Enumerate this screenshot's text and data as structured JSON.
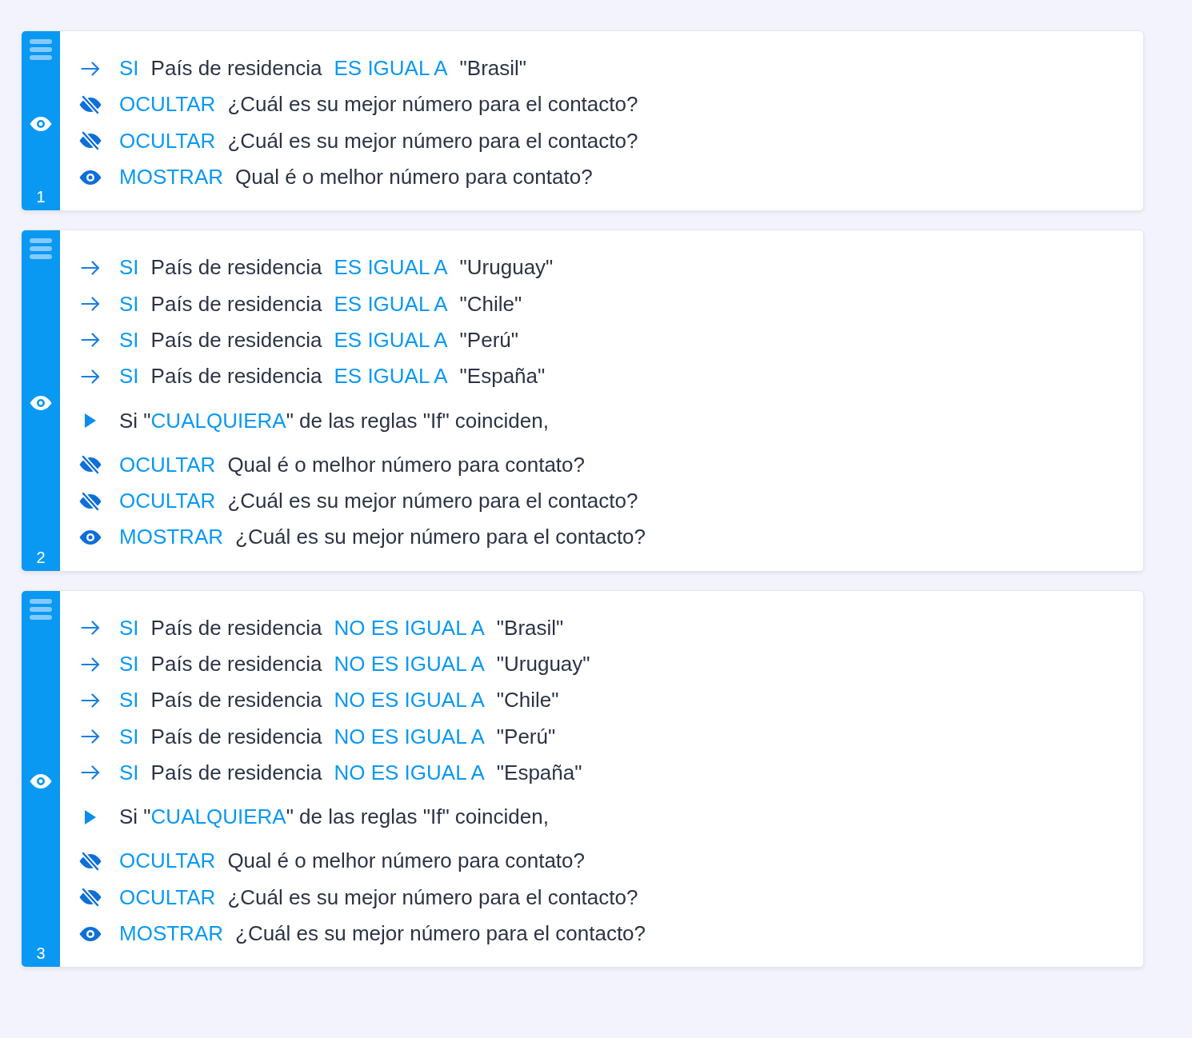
{
  "rules": [
    {
      "number": "1",
      "conditions": [
        {
          "keyword": "SI",
          "field": "País de residencia",
          "operator": "ES IGUAL A",
          "value": "\"Brasil\""
        }
      ],
      "actions": [
        {
          "kind": "hide",
          "verb": "OCULTAR",
          "target": "¿Cuál es su mejor número para el contacto?"
        },
        {
          "kind": "hide",
          "verb": "OCULTAR",
          "target": "¿Cuál es su mejor número para el contacto?"
        },
        {
          "kind": "show",
          "verb": "MOSTRAR",
          "target": "Qual é o melhor número para contato?"
        }
      ]
    },
    {
      "number": "2",
      "conditions": [
        {
          "keyword": "SI",
          "field": "País de residencia",
          "operator": "ES IGUAL A",
          "value": "\"Uruguay\""
        },
        {
          "keyword": "SI",
          "field": "País de residencia",
          "operator": "ES IGUAL A",
          "value": "\"Chile\""
        },
        {
          "keyword": "SI",
          "field": "País de residencia",
          "operator": "ES IGUAL A",
          "value": "\"Perú\""
        },
        {
          "keyword": "SI",
          "field": "País de residencia",
          "operator": "ES IGUAL A",
          "value": "\"España\""
        }
      ],
      "match": {
        "prefix": "Si \"",
        "keyword": "CUALQUIERA",
        "suffix": "\" de las reglas \"If\" coinciden,"
      },
      "actions": [
        {
          "kind": "hide",
          "verb": "OCULTAR",
          "target": "Qual é o melhor número para contato?"
        },
        {
          "kind": "hide",
          "verb": "OCULTAR",
          "target": "¿Cuál es su mejor número para el contacto?"
        },
        {
          "kind": "show",
          "verb": "MOSTRAR",
          "target": "¿Cuál es su mejor número para el contacto?"
        }
      ]
    },
    {
      "number": "3",
      "conditions": [
        {
          "keyword": "SI",
          "field": "País de residencia",
          "operator": "NO ES IGUAL A",
          "value": "\"Brasil\""
        },
        {
          "keyword": "SI",
          "field": "País de residencia",
          "operator": "NO ES IGUAL A",
          "value": "\"Uruguay\""
        },
        {
          "keyword": "SI",
          "field": "País de residencia",
          "operator": "NO ES IGUAL A",
          "value": "\"Chile\""
        },
        {
          "keyword": "SI",
          "field": "País de residencia",
          "operator": "NO ES IGUAL A",
          "value": "\"Perú\""
        },
        {
          "keyword": "SI",
          "field": "País de residencia",
          "operator": "NO ES IGUAL A",
          "value": "\"España\""
        }
      ],
      "match": {
        "prefix": "Si \"",
        "keyword": "CUALQUIERA",
        "suffix": "\" de las reglas \"If\" coinciden,"
      },
      "actions": [
        {
          "kind": "hide",
          "verb": "OCULTAR",
          "target": "Qual é o melhor número para contato?"
        },
        {
          "kind": "hide",
          "verb": "OCULTAR",
          "target": "¿Cuál es su mejor número para el contacto?"
        },
        {
          "kind": "show",
          "verb": "MOSTRAR",
          "target": "¿Cuál es su mejor número para el contacto?"
        }
      ]
    }
  ]
}
